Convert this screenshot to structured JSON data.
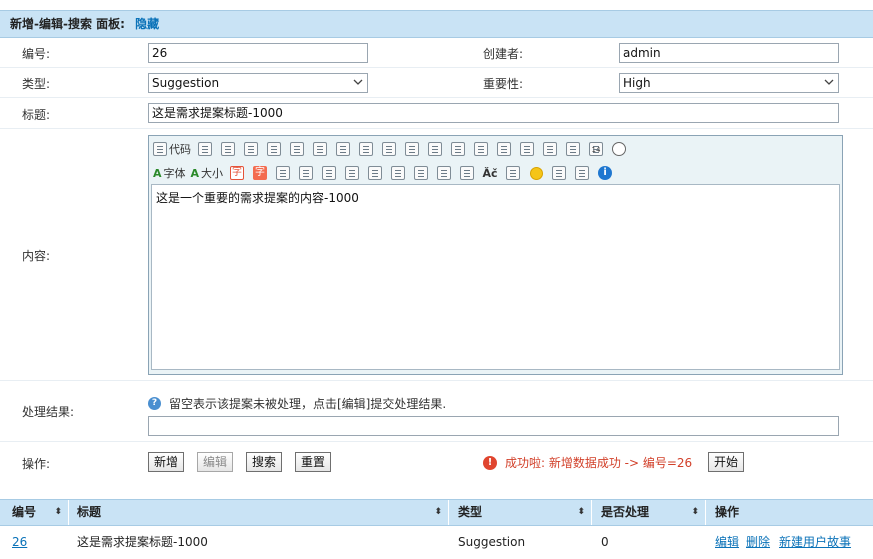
{
  "panel": {
    "title": "新增-编辑-搜索 面板:",
    "hide_link": "隐藏"
  },
  "form": {
    "id_label": "编号:",
    "id_value": "26",
    "creator_label": "创建者:",
    "creator_value": "admin",
    "type_label": "类型:",
    "type_value": "Suggestion",
    "importance_label": "重要性:",
    "importance_value": "High",
    "title_label": "标题:",
    "title_value": "这是需求提案标题-1000",
    "content_label": "内容:",
    "content_value": "这是一个重要的需求提案的内容-1000",
    "result_label": "处理结果:",
    "result_hint": "留空表示该提案未被处理，点击[编辑]提交处理结果.",
    "result_value": "",
    "actions_label": "操作:"
  },
  "editor_toolbar": {
    "code_label": "代码",
    "font_label": "字体",
    "size_label": "大小",
    "char_label": "字",
    "spell_label": "Ǎč",
    "calendar_number": "14",
    "info_label": "i"
  },
  "buttons": {
    "add": "新增",
    "edit": "编辑",
    "search": "搜索",
    "reset": "重置",
    "start": "开始"
  },
  "status": {
    "message": "成功啦: 新增数据成功 -> 编号=26",
    "icon": "!"
  },
  "table": {
    "columns": [
      "编号",
      "标题",
      "类型",
      "是否处理",
      "操作"
    ],
    "rows": [
      {
        "id": "26",
        "title": "这是需求提案标题-1000",
        "type": "Suggestion",
        "processed": "0",
        "actions": [
          "编辑",
          "删除",
          "新建用户故事"
        ]
      }
    ],
    "sort_glyph": "⬍"
  },
  "colors": {
    "header_bg": "#c9e3f5",
    "link": "#0a72b8",
    "error": "#d2402a"
  }
}
